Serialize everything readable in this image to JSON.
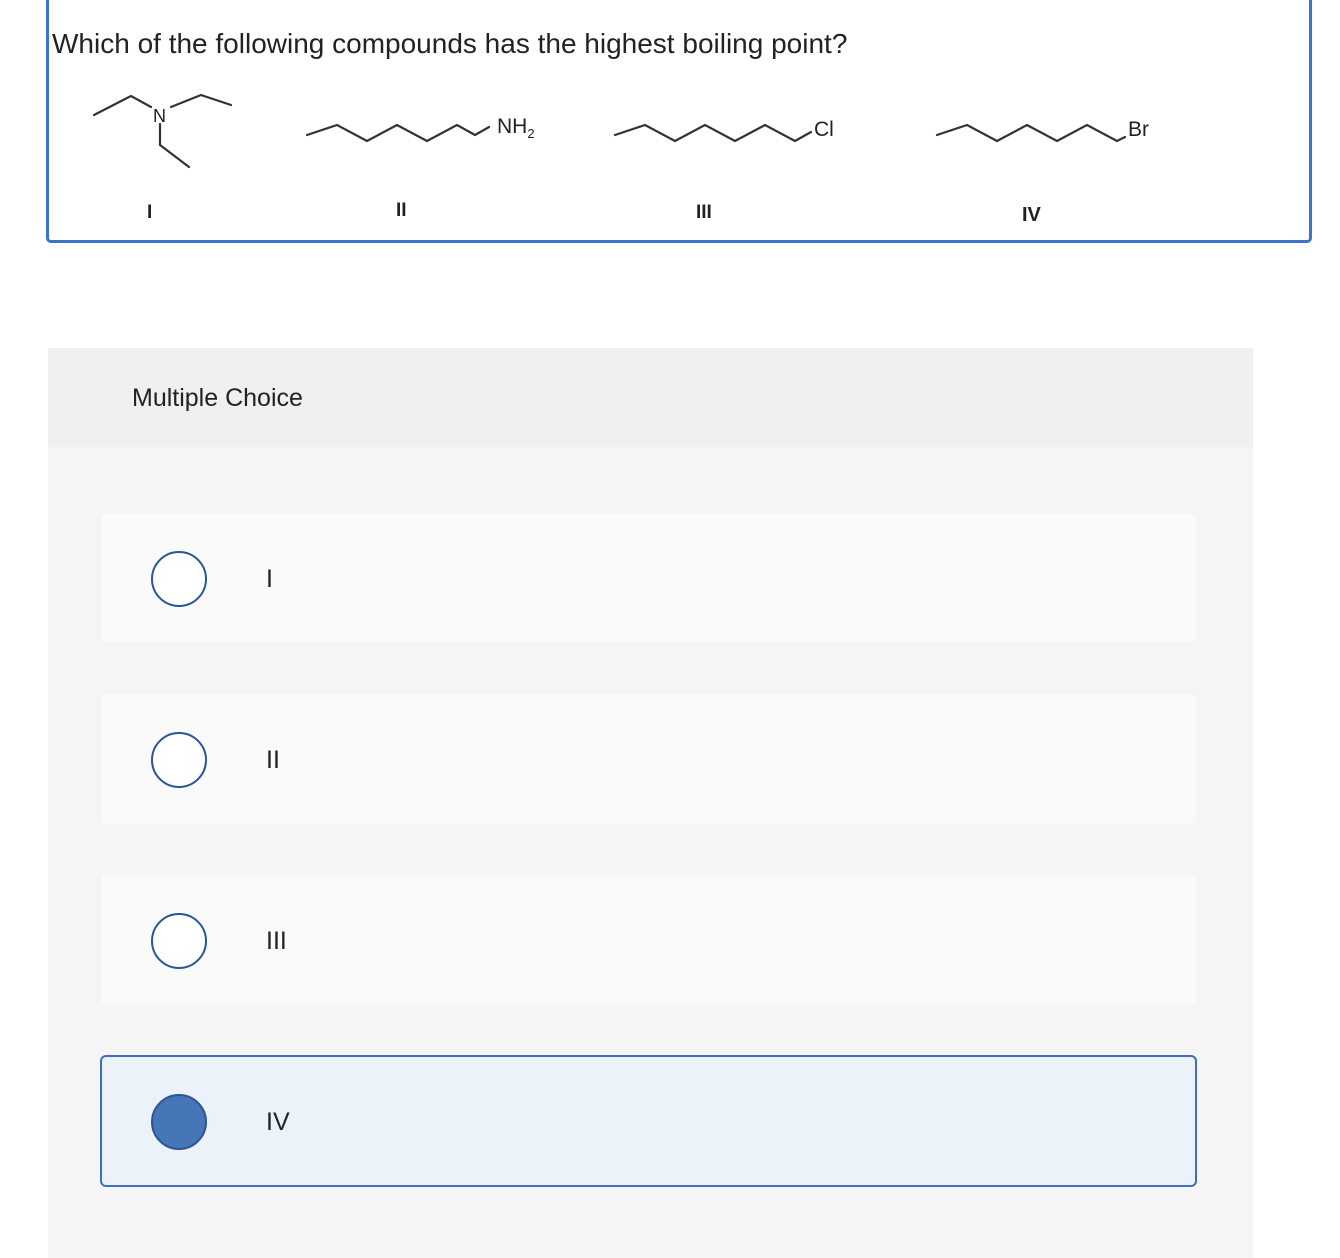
{
  "question": {
    "text": "Which of the following compounds has the highest boiling point?",
    "structures": [
      {
        "atom": "N",
        "numeral": "I"
      },
      {
        "atom": "NH",
        "subscript": "2",
        "numeral": "II"
      },
      {
        "atom": "Cl",
        "numeral": "III"
      },
      {
        "atom": "Br",
        "numeral": "IV"
      }
    ]
  },
  "multiple_choice": {
    "title": "Multiple Choice",
    "options": [
      {
        "label": "I",
        "selected": false
      },
      {
        "label": "II",
        "selected": false
      },
      {
        "label": "III",
        "selected": false
      },
      {
        "label": "IV",
        "selected": true
      }
    ]
  },
  "colors": {
    "accent": "#3b73c8",
    "selected_fill": "#4675b8",
    "selected_bg": "#ecf2fa",
    "panel_bg": "#f5f5f5"
  }
}
